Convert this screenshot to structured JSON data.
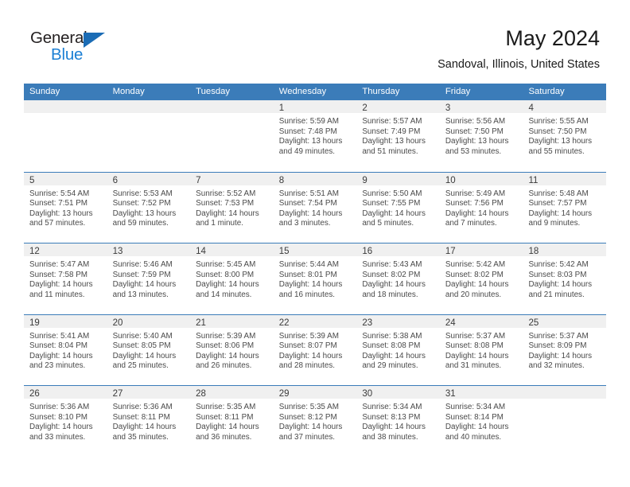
{
  "brand": {
    "name_top": "General",
    "name_bottom": "Blue",
    "accent_color": "#1b7fd4",
    "flag_color": "#1b6cb5"
  },
  "header": {
    "title": "May 2024",
    "subtitle": "Sandoval, Illinois, United States"
  },
  "calendar": {
    "header_bg": "#3b7cb9",
    "daynum_bg": "#f0f0f0",
    "day_names": [
      "Sunday",
      "Monday",
      "Tuesday",
      "Wednesday",
      "Thursday",
      "Friday",
      "Saturday"
    ],
    "weeks": [
      [
        {
          "day": "",
          "empty": true
        },
        {
          "day": "",
          "empty": true
        },
        {
          "day": "",
          "empty": true
        },
        {
          "day": "1",
          "sunrise": "Sunrise: 5:59 AM",
          "sunset": "Sunset: 7:48 PM",
          "daylight1": "Daylight: 13 hours",
          "daylight2": "and 49 minutes."
        },
        {
          "day": "2",
          "sunrise": "Sunrise: 5:57 AM",
          "sunset": "Sunset: 7:49 PM",
          "daylight1": "Daylight: 13 hours",
          "daylight2": "and 51 minutes."
        },
        {
          "day": "3",
          "sunrise": "Sunrise: 5:56 AM",
          "sunset": "Sunset: 7:50 PM",
          "daylight1": "Daylight: 13 hours",
          "daylight2": "and 53 minutes."
        },
        {
          "day": "4",
          "sunrise": "Sunrise: 5:55 AM",
          "sunset": "Sunset: 7:50 PM",
          "daylight1": "Daylight: 13 hours",
          "daylight2": "and 55 minutes."
        }
      ],
      [
        {
          "day": "5",
          "sunrise": "Sunrise: 5:54 AM",
          "sunset": "Sunset: 7:51 PM",
          "daylight1": "Daylight: 13 hours",
          "daylight2": "and 57 minutes."
        },
        {
          "day": "6",
          "sunrise": "Sunrise: 5:53 AM",
          "sunset": "Sunset: 7:52 PM",
          "daylight1": "Daylight: 13 hours",
          "daylight2": "and 59 minutes."
        },
        {
          "day": "7",
          "sunrise": "Sunrise: 5:52 AM",
          "sunset": "Sunset: 7:53 PM",
          "daylight1": "Daylight: 14 hours",
          "daylight2": "and 1 minute."
        },
        {
          "day": "8",
          "sunrise": "Sunrise: 5:51 AM",
          "sunset": "Sunset: 7:54 PM",
          "daylight1": "Daylight: 14 hours",
          "daylight2": "and 3 minutes."
        },
        {
          "day": "9",
          "sunrise": "Sunrise: 5:50 AM",
          "sunset": "Sunset: 7:55 PM",
          "daylight1": "Daylight: 14 hours",
          "daylight2": "and 5 minutes."
        },
        {
          "day": "10",
          "sunrise": "Sunrise: 5:49 AM",
          "sunset": "Sunset: 7:56 PM",
          "daylight1": "Daylight: 14 hours",
          "daylight2": "and 7 minutes."
        },
        {
          "day": "11",
          "sunrise": "Sunrise: 5:48 AM",
          "sunset": "Sunset: 7:57 PM",
          "daylight1": "Daylight: 14 hours",
          "daylight2": "and 9 minutes."
        }
      ],
      [
        {
          "day": "12",
          "sunrise": "Sunrise: 5:47 AM",
          "sunset": "Sunset: 7:58 PM",
          "daylight1": "Daylight: 14 hours",
          "daylight2": "and 11 minutes."
        },
        {
          "day": "13",
          "sunrise": "Sunrise: 5:46 AM",
          "sunset": "Sunset: 7:59 PM",
          "daylight1": "Daylight: 14 hours",
          "daylight2": "and 13 minutes."
        },
        {
          "day": "14",
          "sunrise": "Sunrise: 5:45 AM",
          "sunset": "Sunset: 8:00 PM",
          "daylight1": "Daylight: 14 hours",
          "daylight2": "and 14 minutes."
        },
        {
          "day": "15",
          "sunrise": "Sunrise: 5:44 AM",
          "sunset": "Sunset: 8:01 PM",
          "daylight1": "Daylight: 14 hours",
          "daylight2": "and 16 minutes."
        },
        {
          "day": "16",
          "sunrise": "Sunrise: 5:43 AM",
          "sunset": "Sunset: 8:02 PM",
          "daylight1": "Daylight: 14 hours",
          "daylight2": "and 18 minutes."
        },
        {
          "day": "17",
          "sunrise": "Sunrise: 5:42 AM",
          "sunset": "Sunset: 8:02 PM",
          "daylight1": "Daylight: 14 hours",
          "daylight2": "and 20 minutes."
        },
        {
          "day": "18",
          "sunrise": "Sunrise: 5:42 AM",
          "sunset": "Sunset: 8:03 PM",
          "daylight1": "Daylight: 14 hours",
          "daylight2": "and 21 minutes."
        }
      ],
      [
        {
          "day": "19",
          "sunrise": "Sunrise: 5:41 AM",
          "sunset": "Sunset: 8:04 PM",
          "daylight1": "Daylight: 14 hours",
          "daylight2": "and 23 minutes."
        },
        {
          "day": "20",
          "sunrise": "Sunrise: 5:40 AM",
          "sunset": "Sunset: 8:05 PM",
          "daylight1": "Daylight: 14 hours",
          "daylight2": "and 25 minutes."
        },
        {
          "day": "21",
          "sunrise": "Sunrise: 5:39 AM",
          "sunset": "Sunset: 8:06 PM",
          "daylight1": "Daylight: 14 hours",
          "daylight2": "and 26 minutes."
        },
        {
          "day": "22",
          "sunrise": "Sunrise: 5:39 AM",
          "sunset": "Sunset: 8:07 PM",
          "daylight1": "Daylight: 14 hours",
          "daylight2": "and 28 minutes."
        },
        {
          "day": "23",
          "sunrise": "Sunrise: 5:38 AM",
          "sunset": "Sunset: 8:08 PM",
          "daylight1": "Daylight: 14 hours",
          "daylight2": "and 29 minutes."
        },
        {
          "day": "24",
          "sunrise": "Sunrise: 5:37 AM",
          "sunset": "Sunset: 8:08 PM",
          "daylight1": "Daylight: 14 hours",
          "daylight2": "and 31 minutes."
        },
        {
          "day": "25",
          "sunrise": "Sunrise: 5:37 AM",
          "sunset": "Sunset: 8:09 PM",
          "daylight1": "Daylight: 14 hours",
          "daylight2": "and 32 minutes."
        }
      ],
      [
        {
          "day": "26",
          "sunrise": "Sunrise: 5:36 AM",
          "sunset": "Sunset: 8:10 PM",
          "daylight1": "Daylight: 14 hours",
          "daylight2": "and 33 minutes."
        },
        {
          "day": "27",
          "sunrise": "Sunrise: 5:36 AM",
          "sunset": "Sunset: 8:11 PM",
          "daylight1": "Daylight: 14 hours",
          "daylight2": "and 35 minutes."
        },
        {
          "day": "28",
          "sunrise": "Sunrise: 5:35 AM",
          "sunset": "Sunset: 8:11 PM",
          "daylight1": "Daylight: 14 hours",
          "daylight2": "and 36 minutes."
        },
        {
          "day": "29",
          "sunrise": "Sunrise: 5:35 AM",
          "sunset": "Sunset: 8:12 PM",
          "daylight1": "Daylight: 14 hours",
          "daylight2": "and 37 minutes."
        },
        {
          "day": "30",
          "sunrise": "Sunrise: 5:34 AM",
          "sunset": "Sunset: 8:13 PM",
          "daylight1": "Daylight: 14 hours",
          "daylight2": "and 38 minutes."
        },
        {
          "day": "31",
          "sunrise": "Sunrise: 5:34 AM",
          "sunset": "Sunset: 8:14 PM",
          "daylight1": "Daylight: 14 hours",
          "daylight2": "and 40 minutes."
        },
        {
          "day": "",
          "empty": true
        }
      ]
    ]
  }
}
